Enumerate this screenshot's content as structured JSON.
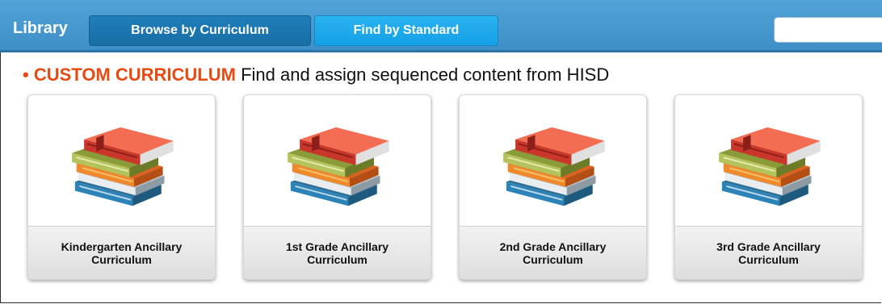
{
  "header": {
    "title": "Library",
    "tabs": [
      {
        "label": "Browse by Curriculum",
        "active": true
      },
      {
        "label": "Find by Standard",
        "active": false
      }
    ],
    "search": {
      "value": "",
      "placeholder": ""
    }
  },
  "section": {
    "bullet": "•",
    "label": "CUSTOM CURRICULUM",
    "description": "Find and assign sequenced content from HISD"
  },
  "cards": [
    {
      "title": "Kindergarten Ancillary Curriculum",
      "icon": "books-stack-icon"
    },
    {
      "title": "1st Grade Ancillary Curriculum",
      "icon": "books-stack-icon"
    },
    {
      "title": "2nd Grade Ancillary Curriculum",
      "icon": "books-stack-icon"
    },
    {
      "title": "3rd Grade Ancillary Curriculum",
      "icon": "books-stack-icon"
    }
  ],
  "colors": {
    "header_bar": "#4a9dd3",
    "active_tab": "#1f7db9",
    "inactive_tab": "#1ea8ec",
    "heading_accent": "#e84b12"
  }
}
